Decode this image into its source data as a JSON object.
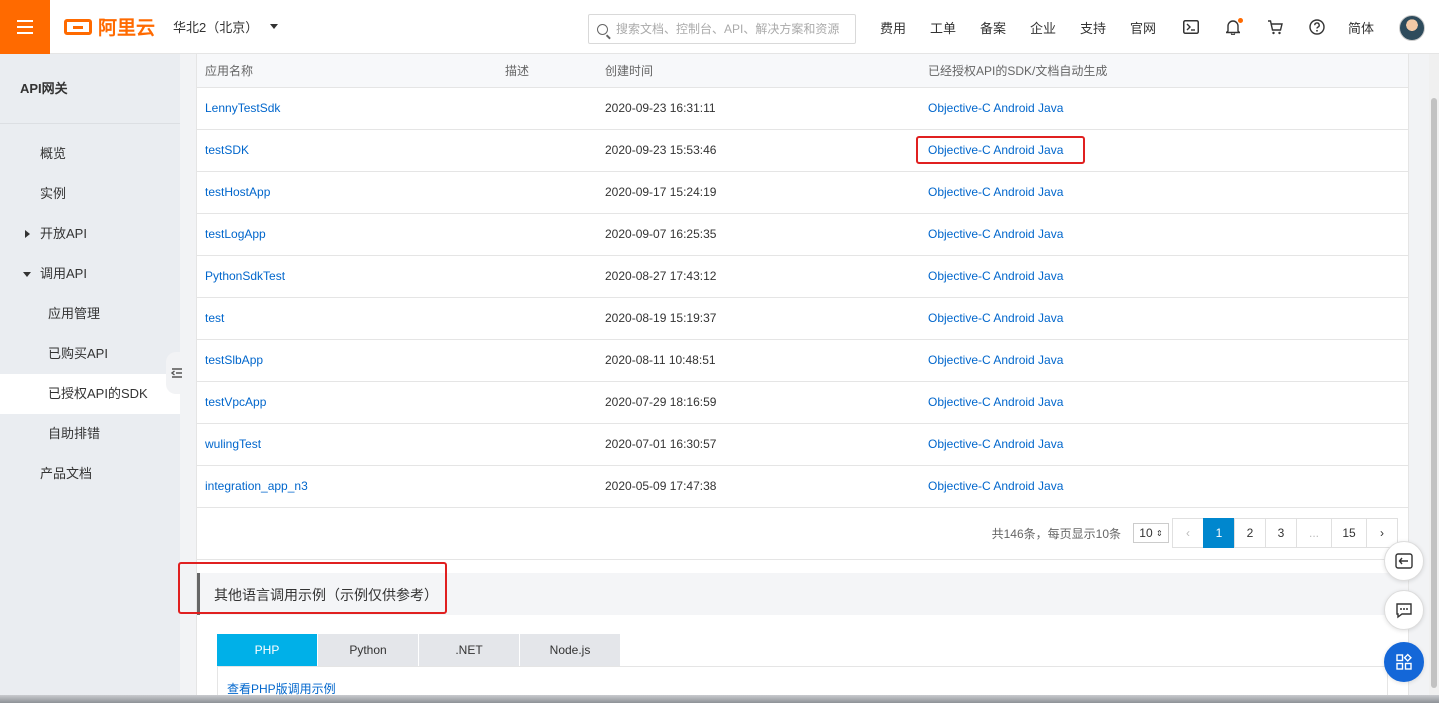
{
  "header": {
    "brand": "阿里云",
    "region": "华北2（北京）",
    "search_placeholder": "搜索文档、控制台、API、解决方案和资源",
    "nav": [
      "费用",
      "工单",
      "备案",
      "企业",
      "支持",
      "官网"
    ],
    "lang": "简体",
    "icons": [
      "terminal-icon",
      "bell-icon",
      "cart-icon",
      "help-icon"
    ]
  },
  "sidebar": {
    "title": "API网关",
    "items": [
      {
        "label": "概览"
      },
      {
        "label": "实例"
      },
      {
        "label": "开放API"
      },
      {
        "label": "调用API"
      },
      {
        "label": "应用管理"
      },
      {
        "label": "已购买API"
      },
      {
        "label": "已授权API的SDK"
      },
      {
        "label": "自助排错"
      },
      {
        "label": "产品文档"
      }
    ]
  },
  "table": {
    "headers": [
      "应用名称",
      "描述",
      "创建时间",
      "已经授权API的SDK/文档自动生成"
    ],
    "rows": [
      {
        "name": "LennyTestSdk",
        "desc": "",
        "created": "2020-09-23 16:31:11",
        "sdk": "Objective-C Android Java"
      },
      {
        "name": "testSDK",
        "desc": "",
        "created": "2020-09-23 15:53:46",
        "sdk": "Objective-C Android Java"
      },
      {
        "name": "testHostApp",
        "desc": "",
        "created": "2020-09-17 15:24:19",
        "sdk": "Objective-C Android Java"
      },
      {
        "name": "testLogApp",
        "desc": "",
        "created": "2020-09-07 16:25:35",
        "sdk": "Objective-C Android Java"
      },
      {
        "name": "PythonSdkTest",
        "desc": "",
        "created": "2020-08-27 17:43:12",
        "sdk": "Objective-C Android Java"
      },
      {
        "name": "test",
        "desc": "",
        "created": "2020-08-19 15:19:37",
        "sdk": "Objective-C Android Java"
      },
      {
        "name": "testSlbApp",
        "desc": "",
        "created": "2020-08-11 10:48:51",
        "sdk": "Objective-C Android Java"
      },
      {
        "name": "testVpcApp",
        "desc": "",
        "created": "2020-07-29 18:16:59",
        "sdk": "Objective-C Android Java"
      },
      {
        "name": "wulingTest",
        "desc": "",
        "created": "2020-07-01 16:30:57",
        "sdk": "Objective-C Android Java"
      },
      {
        "name": "integration_app_n3",
        "desc": "",
        "created": "2020-05-09 17:47:38",
        "sdk": "Objective-C Android Java"
      }
    ]
  },
  "pager": {
    "summary": "共146条，每页显示10条",
    "page_size": "10",
    "prev": "‹",
    "next": "›",
    "pages": [
      "1",
      "2",
      "3",
      "...",
      "15"
    ],
    "current": "1"
  },
  "examples": {
    "title": "其他语言调用示例（示例仅供参考）",
    "tabs": [
      "PHP",
      "Python",
      ".NET",
      "Node.js"
    ],
    "active_tab": "PHP",
    "link": "查看PHP版调用示例"
  },
  "colors": {
    "brand": "#ff6a00",
    "link": "#0066cc",
    "active_page": "#0087ce",
    "active_tab": "#00b0e8",
    "highlight": "#e02020"
  }
}
